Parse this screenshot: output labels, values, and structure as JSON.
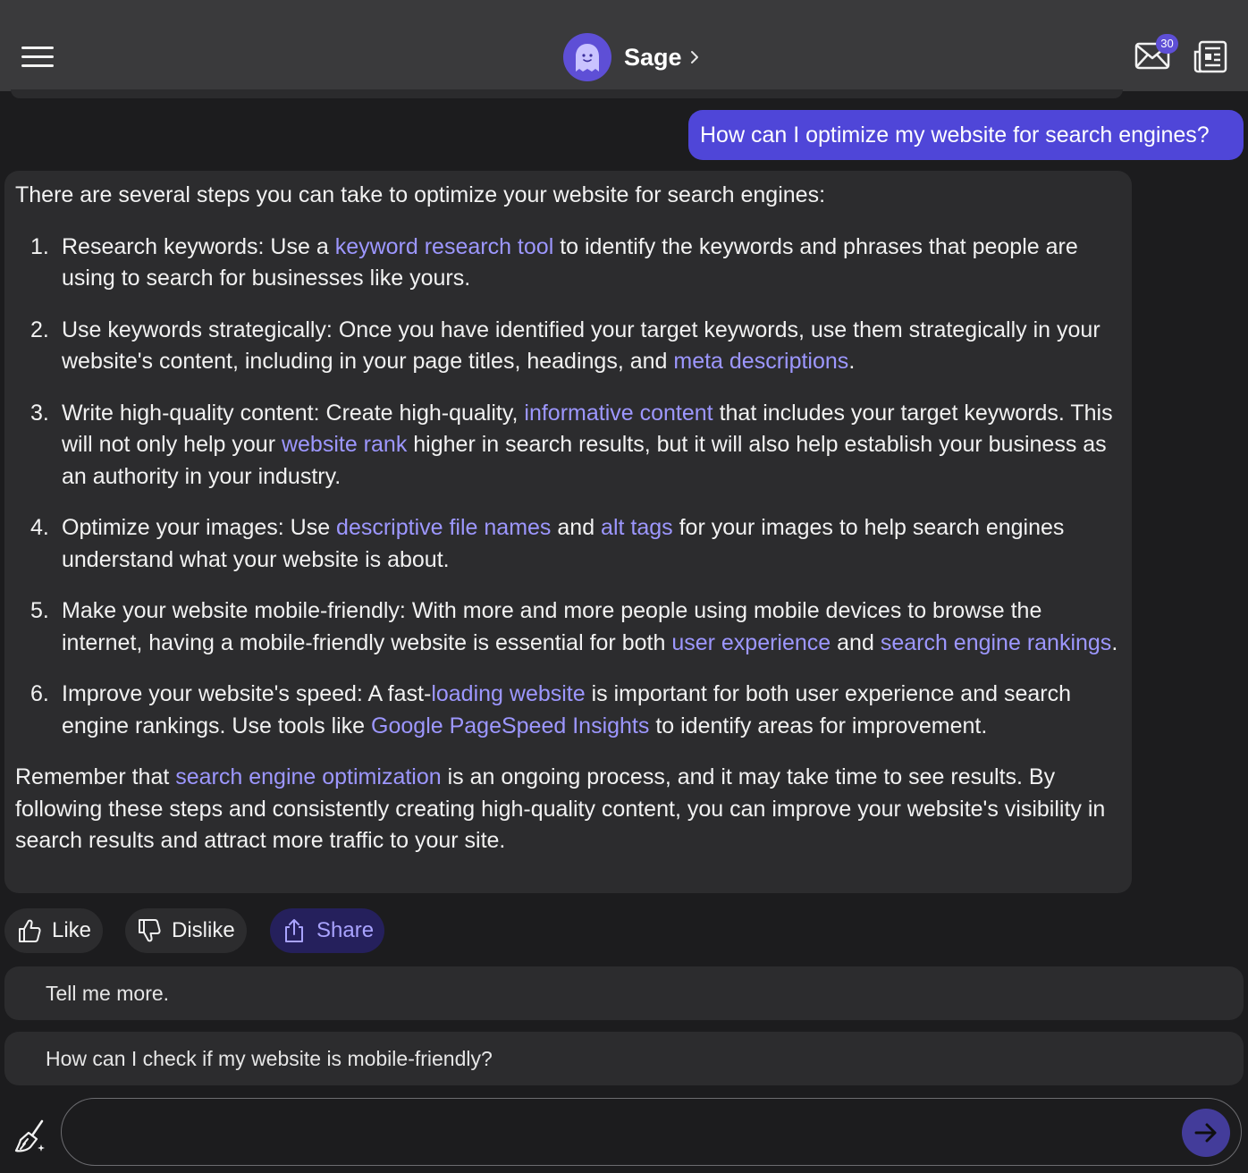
{
  "header": {
    "bot_name": "Sage",
    "mail_badge_count": "30",
    "menu_icon": "hamburger-menu-icon",
    "mail_icon": "envelope-icon",
    "feed_icon": "newspaper-icon",
    "accent_color": "#5e4fd6"
  },
  "user_message": {
    "text": "How can I optimize my website for search engines?"
  },
  "bot_message": {
    "intro": "There are several steps you can take to optimize your website for search engines:",
    "steps": [
      {
        "num": "1.",
        "parts": [
          {
            "t": "Research keywords: Use a "
          },
          {
            "t": "keyword research tool",
            "link": true
          },
          {
            "t": " to identify the keywords and phrases that people are using to search for businesses like yours."
          }
        ]
      },
      {
        "num": "2.",
        "parts": [
          {
            "t": "Use keywords strategically: Once you have identified your target keywords, use them strategically in your website's content, including in your page titles, headings, and "
          },
          {
            "t": "meta descriptions",
            "link": true
          },
          {
            "t": "."
          }
        ]
      },
      {
        "num": "3.",
        "parts": [
          {
            "t": "Write high-quality content: Create high-quality, "
          },
          {
            "t": "informative content",
            "link": true
          },
          {
            "t": " that includes your target keywords. This will not only help your "
          },
          {
            "t": "website rank",
            "link": true
          },
          {
            "t": " higher in search results, but it will also help establish your business as an authority in your industry."
          }
        ]
      },
      {
        "num": "4.",
        "parts": [
          {
            "t": "Optimize your images: Use "
          },
          {
            "t": "descriptive file names",
            "link": true
          },
          {
            "t": " and "
          },
          {
            "t": "alt tags",
            "link": true
          },
          {
            "t": " for your images to help search engines understand what your website is about."
          }
        ]
      },
      {
        "num": "5.",
        "parts": [
          {
            "t": "Make your website mobile-friendly: With more and more people using mobile devices to browse the internet, having a mobile-friendly website is essential for both "
          },
          {
            "t": "user experience",
            "link": true
          },
          {
            "t": " and "
          },
          {
            "t": "search engine rankings",
            "link": true
          },
          {
            "t": "."
          }
        ]
      },
      {
        "num": "6.",
        "parts": [
          {
            "t": "Improve your website's speed: A fast-"
          },
          {
            "t": "loading website",
            "link": true
          },
          {
            "t": " is important for both user experience and search engine rankings. Use tools like "
          },
          {
            "t": "Google PageSpeed Insights",
            "link": true
          },
          {
            "t": " to identify areas for improvement."
          }
        ]
      }
    ],
    "outro_parts": [
      {
        "t": "Remember that "
      },
      {
        "t": "search engine optimization",
        "link": true
      },
      {
        "t": " is an ongoing process, and it may take time to see results. By following these steps and consistently creating high-quality content, you can improve your website's visibility in search results and attract more traffic to your site."
      }
    ]
  },
  "reactions": {
    "like_label": "Like",
    "dislike_label": "Dislike",
    "share_label": "Share"
  },
  "suggestions": [
    "Tell me more.",
    "How can I check if my website is mobile-friendly?"
  ],
  "composer": {
    "value": "",
    "placeholder": "",
    "clear_icon": "broom-icon",
    "send_icon": "arrow-right-icon"
  }
}
